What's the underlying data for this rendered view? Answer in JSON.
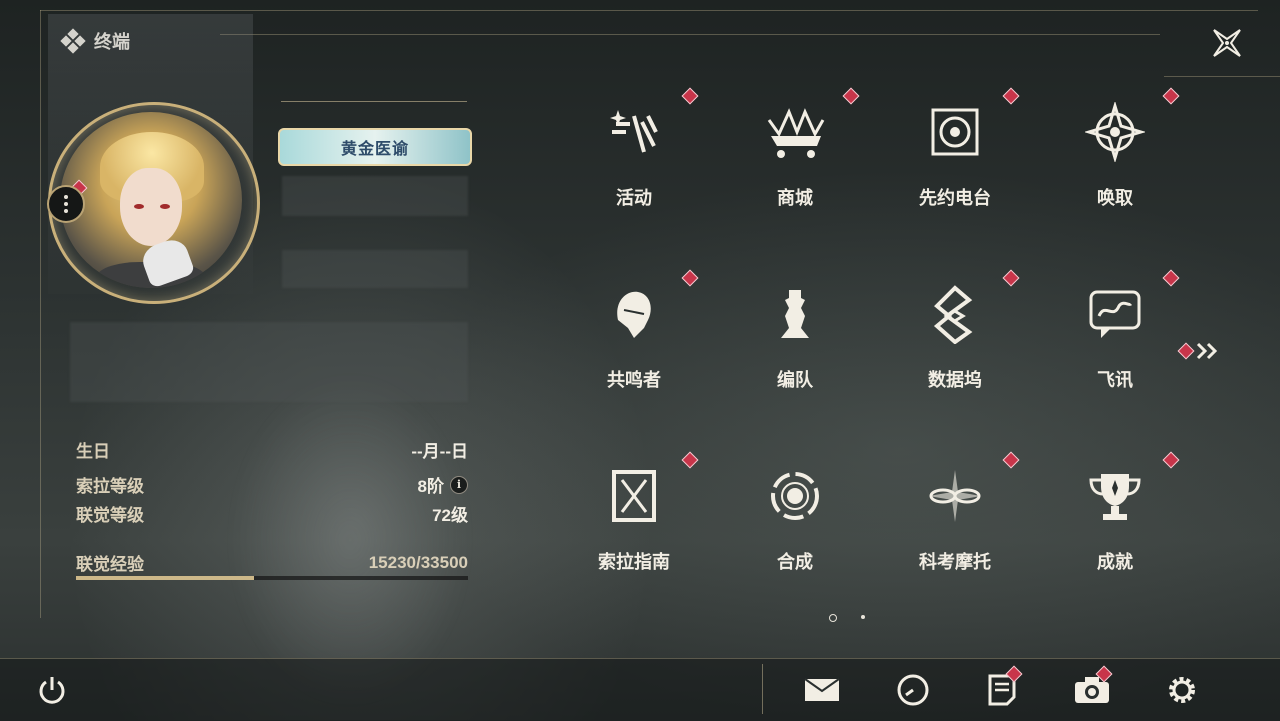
{
  "header": {
    "title": "终端"
  },
  "profile": {
    "title_badge": "黄金医谕",
    "stats": [
      {
        "label": "生日",
        "value": "--月--日"
      },
      {
        "label": "索拉等级",
        "value": "8阶"
      },
      {
        "label": "联觉等级",
        "value": "72级"
      },
      {
        "label": "联觉经验",
        "value": "15230/33500"
      }
    ],
    "exp_current": 15230,
    "exp_max": 33500
  },
  "menu": {
    "items": [
      {
        "label": "活动",
        "icon": "activity-icon",
        "badge": true
      },
      {
        "label": "商城",
        "icon": "shop-cart-icon",
        "badge": true
      },
      {
        "label": "先约电台",
        "icon": "radio-icon",
        "badge": true
      },
      {
        "label": "唤取",
        "icon": "compass-icon",
        "badge": true
      },
      {
        "label": "共鸣者",
        "icon": "resonator-icon",
        "badge": true
      },
      {
        "label": "编队",
        "icon": "chess-icon",
        "badge": false
      },
      {
        "label": "数据坞",
        "icon": "data-dock-icon",
        "badge": true
      },
      {
        "label": "飞讯",
        "icon": "message-icon",
        "badge": true
      },
      {
        "label": "索拉指南",
        "icon": "guide-icon",
        "badge": true
      },
      {
        "label": "合成",
        "icon": "synthesis-icon",
        "badge": false
      },
      {
        "label": "科考摩托",
        "icon": "motorcycle-icon",
        "badge": true
      },
      {
        "label": "成就",
        "icon": "trophy-icon",
        "badge": true
      }
    ],
    "page": 1,
    "page_count": 2
  },
  "colors": {
    "accent_gold": "#c9b07a",
    "badge_red": "#c8354a",
    "text": "#f2eee4"
  }
}
